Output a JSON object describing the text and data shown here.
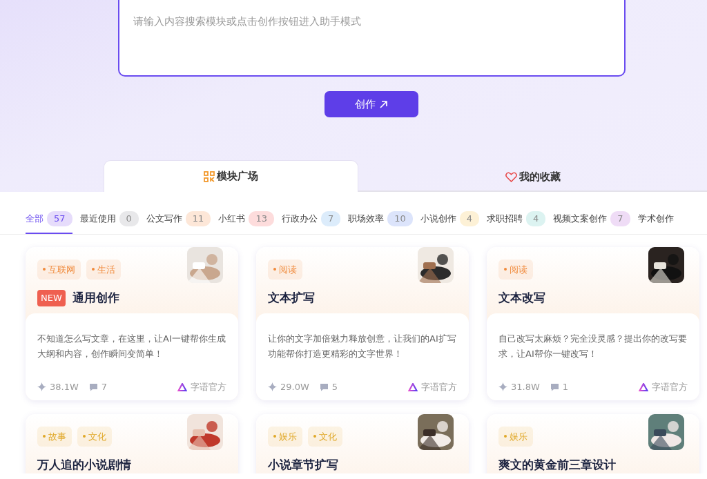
{
  "search": {
    "placeholder": "请输入内容搜索模块或点击创作按钮进入助手模式"
  },
  "create_button": {
    "label": "创作"
  },
  "tabs": [
    {
      "label": "模块广场",
      "selected": true,
      "kind": "grid"
    },
    {
      "label": "我的收藏",
      "selected": false,
      "kind": "heart"
    }
  ],
  "categories": [
    {
      "label": "全部",
      "count": "57",
      "selected": true,
      "color": "#e6dcfb"
    },
    {
      "label": "最近使用",
      "count": "0",
      "selected": false,
      "color": "#e8e8ea"
    },
    {
      "label": "公文写作",
      "count": "11",
      "selected": false,
      "color": "#fde7d8"
    },
    {
      "label": "小红书",
      "count": "13",
      "selected": false,
      "color": "#fddcdc"
    },
    {
      "label": "行政办公",
      "count": "7",
      "selected": false,
      "color": "#dcecfb"
    },
    {
      "label": "职场效率",
      "count": "10",
      "selected": false,
      "color": "#dce4fb"
    },
    {
      "label": "小说创作",
      "count": "4",
      "selected": false,
      "color": "#fdf1d6"
    },
    {
      "label": "求职招聘",
      "count": "4",
      "selected": false,
      "color": "#dcf3f1"
    },
    {
      "label": "视频文案创作",
      "count": "7",
      "selected": false,
      "color": "#efdcf6"
    },
    {
      "label": "学术创作",
      "selected": false
    }
  ],
  "cards": [
    {
      "tags": [
        {
          "label": "互联网",
          "color": "#f08a3c"
        },
        {
          "label": "生活",
          "color": "#f08a3c"
        }
      ],
      "new": true,
      "new_label": "NEW",
      "title": "通用创作",
      "description": "不知道怎么写文章，在这里，让AI一键帮你生成大纲和内容，创作瞬间变简单！",
      "uses": "38.1W",
      "comments": "7",
      "author": "字语官方"
    },
    {
      "tags": [
        {
          "label": "阅读",
          "color": "#f08a3c"
        }
      ],
      "new": false,
      "title": "文本扩写",
      "description": "让你的文字加倍魅力释放创意，让我们的AI扩写功能帮你打造更精彩的文字世界！",
      "uses": "29.0W",
      "comments": "5",
      "author": "字语官方"
    },
    {
      "tags": [
        {
          "label": "阅读",
          "color": "#f08a3c"
        }
      ],
      "new": false,
      "title": "文本改写",
      "description": "自己改写太麻烦？完全没灵感？提出你的改写要求，让AI帮你一键改写！",
      "uses": "31.8W",
      "comments": "1",
      "author": "字语官方"
    },
    {
      "tags": [
        {
          "label": "故事",
          "color": "#e0a828"
        },
        {
          "label": "文化",
          "color": "#e0a828"
        }
      ],
      "new": false,
      "title": "万人追的小说剧情"
    },
    {
      "tags": [
        {
          "label": "娱乐",
          "color": "#e0a828"
        },
        {
          "label": "文化",
          "color": "#e0a828"
        }
      ],
      "new": false,
      "title": "小说章节扩写"
    },
    {
      "tags": [
        {
          "label": "娱乐",
          "color": "#e0a828"
        }
      ],
      "new": false,
      "title": "爽文的黄金前三章设计"
    }
  ]
}
